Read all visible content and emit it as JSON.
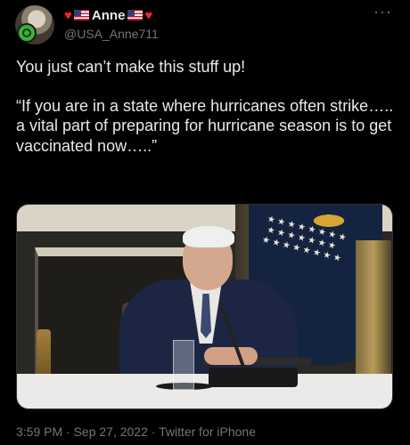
{
  "author": {
    "display_name": "Anne",
    "handle": "@USA_Anne711",
    "name_decorations": [
      "red-heart",
      "us-flag",
      "us-flag",
      "red-heart"
    ]
  },
  "tweet": {
    "line1": "You just can’t make this stuff up!",
    "quote": "“If you are in a state where hurricanes often strike….. a vital part of preparing for hurricane season is to get vaccinated now…..”"
  },
  "media": {
    "type": "video-still",
    "subject": "man seated at table with microphone"
  },
  "meta": {
    "text": "3:59 PM · Sep 27, 2022 · Twitter for iPhone"
  },
  "icons": {
    "more": "more-horizontal-icon",
    "heart": "heart-icon",
    "flag": "us-flag-icon"
  },
  "colors": {
    "background": "#000000",
    "text_primary": "#e7e9ea",
    "text_secondary": "#71767b",
    "heart": "#f4212e"
  }
}
